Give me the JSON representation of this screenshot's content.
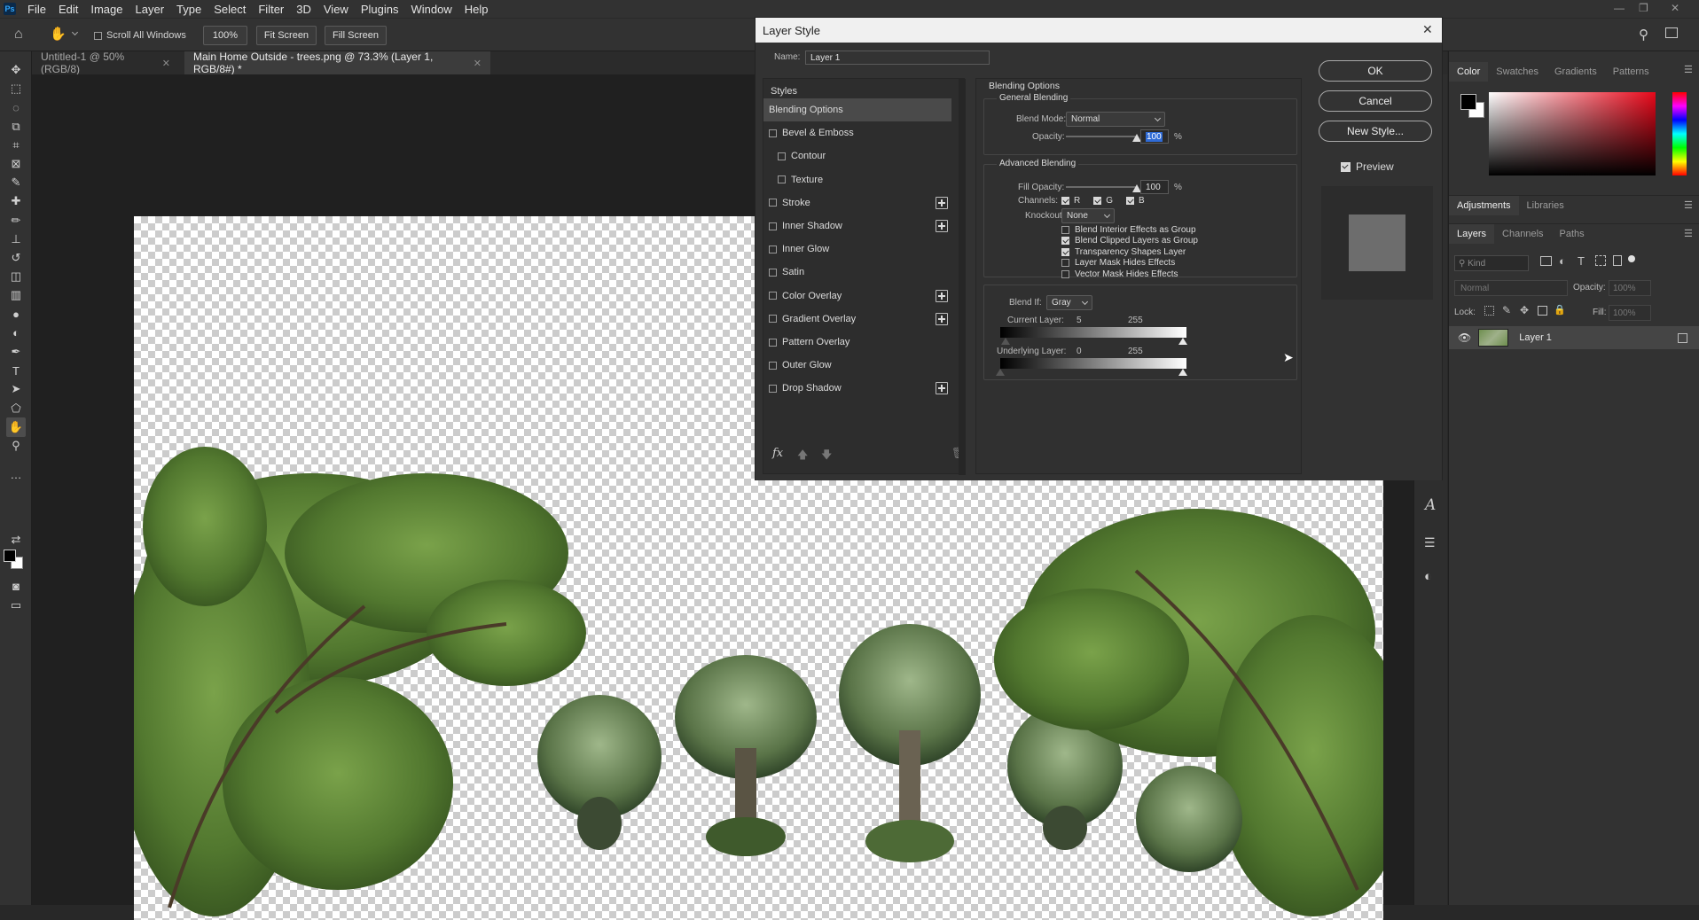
{
  "app": {
    "logo": "Ps",
    "menu": [
      "File",
      "Edit",
      "Image",
      "Layer",
      "Type",
      "Select",
      "Filter",
      "3D",
      "View",
      "Plugins",
      "Window",
      "Help"
    ],
    "window_controls": [
      "minimize-icon",
      "restore-icon",
      "close-icon"
    ]
  },
  "options_bar": {
    "scroll_all_windows_label": "Scroll All Windows",
    "scroll_all_windows_checked": false,
    "zoom_label": "100%",
    "fit_screen_label": "Fit Screen",
    "fill_screen_label": "Fill Screen"
  },
  "document_tabs": [
    {
      "label": "Untitled-1 @ 50% (RGB/8)",
      "active": false
    },
    {
      "label": "Main Home Outside - trees.png @ 73.3% (Layer 1, RGB/8#) *",
      "active": true
    }
  ],
  "tools": [
    "move-tool-icon",
    "marquee-tool-icon",
    "lasso-tool-icon",
    "object-select-icon",
    "crop-tool-icon",
    "frame-tool-icon",
    "eyedropper-icon",
    "healing-brush-icon",
    "brush-tool-icon",
    "clone-stamp-icon",
    "history-brush-icon",
    "eraser-icon",
    "gradient-tool-icon",
    "blur-tool-icon",
    "dodge-tool-icon",
    "pen-tool-icon",
    "type-tool-icon",
    "path-select-icon",
    "shape-tool-icon",
    "hand-tool-icon",
    "zoom-tool-icon",
    "more-tools-icon",
    "color-swap-icon",
    "quick-mask-icon",
    "screen-mode-icon"
  ],
  "dialog": {
    "title": "Layer Style",
    "name_label": "Name:",
    "name_value": "Layer 1",
    "styles_header": "Styles",
    "style_list": [
      {
        "label": "Blending Options",
        "checkbox": false,
        "selected": true,
        "plus": false,
        "indent": false
      },
      {
        "label": "Bevel & Emboss",
        "checkbox": true,
        "checked": false,
        "plus": false,
        "indent": false
      },
      {
        "label": "Contour",
        "checkbox": true,
        "checked": false,
        "plus": false,
        "indent": true
      },
      {
        "label": "Texture",
        "checkbox": true,
        "checked": false,
        "plus": false,
        "indent": true
      },
      {
        "label": "Stroke",
        "checkbox": true,
        "checked": false,
        "plus": true,
        "indent": false
      },
      {
        "label": "Inner Shadow",
        "checkbox": true,
        "checked": false,
        "plus": true,
        "indent": false
      },
      {
        "label": "Inner Glow",
        "checkbox": true,
        "checked": false,
        "plus": false,
        "indent": false
      },
      {
        "label": "Satin",
        "checkbox": true,
        "checked": false,
        "plus": false,
        "indent": false
      },
      {
        "label": "Color Overlay",
        "checkbox": true,
        "checked": false,
        "plus": true,
        "indent": false
      },
      {
        "label": "Gradient Overlay",
        "checkbox": true,
        "checked": false,
        "plus": true,
        "indent": false
      },
      {
        "label": "Pattern Overlay",
        "checkbox": true,
        "checked": false,
        "plus": false,
        "indent": false
      },
      {
        "label": "Outer Glow",
        "checkbox": true,
        "checked": false,
        "plus": false,
        "indent": false
      },
      {
        "label": "Drop Shadow",
        "checkbox": true,
        "checked": false,
        "plus": true,
        "indent": false
      }
    ],
    "footer_icons": [
      "fx-icon",
      "move-up-icon",
      "move-down-icon",
      "trash-icon"
    ],
    "fx_label": "fx",
    "blending_options_title": "Blending Options",
    "general_blending_title": "General Blending",
    "blend_mode_label": "Blend Mode:",
    "blend_mode_value": "Normal",
    "opacity_label": "Opacity:",
    "opacity_value": "100",
    "opacity_slider_fraction": 1.0,
    "percent_sign": "%",
    "advanced_blending_title": "Advanced Blending",
    "fill_opacity_label": "Fill Opacity:",
    "fill_opacity_value": "100",
    "fill_opacity_slider_fraction": 1.0,
    "channels_label": "Channels:",
    "channels": [
      {
        "label": "R",
        "checked": true
      },
      {
        "label": "G",
        "checked": true
      },
      {
        "label": "B",
        "checked": true
      }
    ],
    "knockout_label": "Knockout:",
    "knockout_value": "None",
    "advanced_checks": [
      {
        "label": "Blend Interior Effects as Group",
        "checked": false
      },
      {
        "label": "Blend Clipped Layers as Group",
        "checked": true
      },
      {
        "label": "Transparency Shapes Layer",
        "checked": true
      },
      {
        "label": "Layer Mask Hides Effects",
        "checked": false
      },
      {
        "label": "Vector Mask Hides Effects",
        "checked": false
      }
    ],
    "blend_if_label": "Blend If:",
    "blend_if_value": "Gray",
    "current_layer_label": "Current Layer:",
    "current_layer_low": "5",
    "current_layer_high": "255",
    "underlying_layer_label": "Underlying Layer:",
    "underlying_layer_low": "0",
    "underlying_layer_high": "255",
    "ok_label": "OK",
    "cancel_label": "Cancel",
    "new_style_label": "New Style...",
    "preview_label": "Preview",
    "preview_checked": true
  },
  "right_panel": {
    "color_tabs": [
      "Color",
      "Swatches",
      "Gradients",
      "Patterns"
    ],
    "adjustments_tabs": [
      "Adjustments",
      "Libraries"
    ],
    "layers_tabs": [
      "Layers",
      "Channels",
      "Paths"
    ],
    "filter_kind_placeholder": "Kind",
    "blend_mode_value": "Normal",
    "opacity_label": "Opacity:",
    "opacity_value": "100%",
    "lock_label": "Lock:",
    "fill_label": "Fill:",
    "fill_value": "100%",
    "layers": [
      {
        "name": "Layer 1",
        "visible": true
      }
    ]
  },
  "colors": {
    "accent_green_arrow": "#22dd22",
    "color_field_hue": "#e8081a",
    "foreground": "#000000",
    "background": "#ffffff"
  }
}
